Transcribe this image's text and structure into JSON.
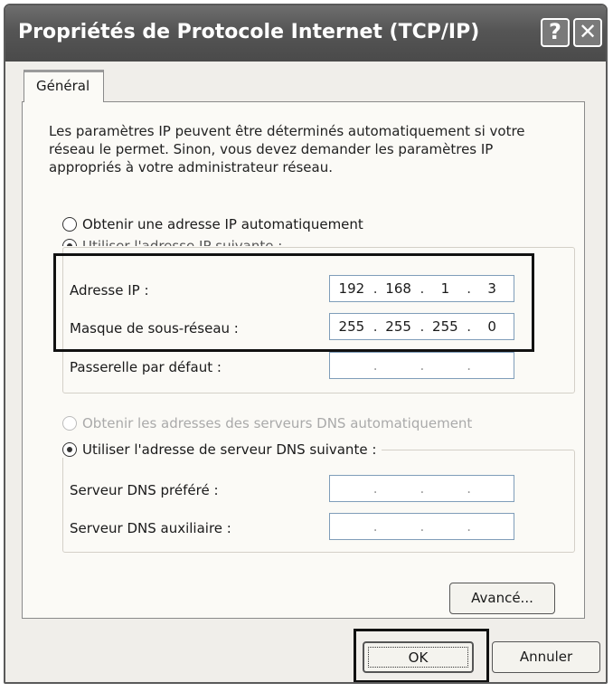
{
  "window": {
    "title": "Propriétés de Protocole Internet (TCP/IP)",
    "help_button": "?",
    "close_button": "✕"
  },
  "tabs": [
    {
      "label": "Général",
      "selected": true
    }
  ],
  "intro_text": "Les paramètres IP peuvent être déterminés automatiquement si votre réseau le permet. Sinon, vous devez demander les paramètres IP appropriés à votre administrateur réseau.",
  "ip_mode": {
    "auto_label": "Obtenir une adresse IP automatiquement",
    "auto_checked": false,
    "manual_label": "Utiliser l'adresse IP suivante :",
    "manual_checked": true
  },
  "ip_fields": {
    "address": {
      "label": "Adresse IP :",
      "octets": [
        "192",
        "168",
        "1",
        "3"
      ]
    },
    "subnet": {
      "label": "Masque de sous-réseau :",
      "octets": [
        "255",
        "255",
        "255",
        "0"
      ]
    },
    "gateway": {
      "label": "Passerelle par défaut :",
      "octets": [
        "",
        "",
        "",
        ""
      ]
    }
  },
  "dns_mode": {
    "auto_label": "Obtenir les adresses des serveurs DNS automatiquement",
    "auto_enabled": false,
    "auto_checked": false,
    "manual_label": "Utiliser l'adresse de serveur DNS suivante :",
    "manual_checked": true
  },
  "dns_fields": {
    "preferred": {
      "label": "Serveur DNS préféré :",
      "octets": [
        "",
        "",
        "",
        ""
      ]
    },
    "alternate": {
      "label": "Serveur DNS auxiliaire :",
      "octets": [
        "",
        "",
        "",
        ""
      ]
    }
  },
  "buttons": {
    "advanced": "Avancé...",
    "ok": "OK",
    "cancel": "Annuler"
  }
}
